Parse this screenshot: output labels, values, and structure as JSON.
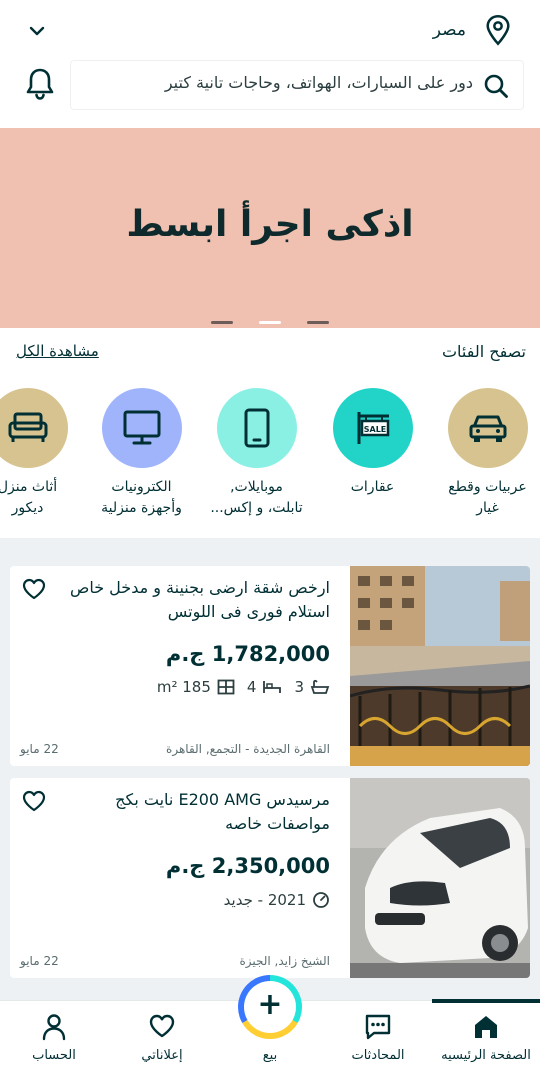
{
  "header": {
    "location": "مصر",
    "search_placeholder": "دور على السيارات، الهواتف، وحاجات تانية كتير"
  },
  "banner": {
    "text": "اذكى اجرأ ابسط",
    "slides": 3,
    "active_slide": 2
  },
  "categories": {
    "title": "تصفح الفئات",
    "view_all": "مشاهدة الكل",
    "items": [
      {
        "line1": "عربيات وقطع",
        "line2": "غيار",
        "color": "#d6c38f",
        "icon": "car-icon"
      },
      {
        "line1": "عقارات",
        "line2": "",
        "color": "#22d4c8",
        "icon": "sale-sign-icon"
      },
      {
        "line1": "موبايلات,",
        "line2": "تابلت، و إكس...",
        "color": "#8af0e4",
        "icon": "mobile-icon"
      },
      {
        "line1": "الكترونيات",
        "line2": "وأجهزة منزلية",
        "color": "#9fb4fb",
        "icon": "monitor-icon"
      },
      {
        "line1": "أثاث منزل",
        "line2": "ديكور",
        "color": "#d6c38f",
        "icon": "sofa-icon"
      }
    ]
  },
  "listings": [
    {
      "title": "ارخص شقة ارضى بجنينة و مدخل خاص استلام فورى فى اللوتس",
      "price": "1,782,000 ج.م",
      "area": "185 m²",
      "baths": "4",
      "beds": "3",
      "location": "القاهرة الجديدة - التجمع, القاهرة",
      "date": "22 مايو"
    },
    {
      "title": "مرسيدس E200 AMG نايت بكج مواصفات خاصه",
      "price": "2,350,000 ج.م",
      "year_condition": "2021 - جديد",
      "location": "الشيخ زايد, الجيزة",
      "date": "22 مايو"
    }
  ],
  "nav": {
    "home": "الصفحة الرئيسيه",
    "chats": "المحادثات",
    "sell": "بيع",
    "my_ads": "إعلاناتي",
    "account": "الحساب"
  },
  "colors": {
    "primary": "#002f34",
    "banner_bg": "#f0c0b0",
    "banner_ring": "#e13a26",
    "sell_teal": "#23e5db",
    "sell_yellow": "#ffce32",
    "sell_blue": "#3a77ff"
  }
}
